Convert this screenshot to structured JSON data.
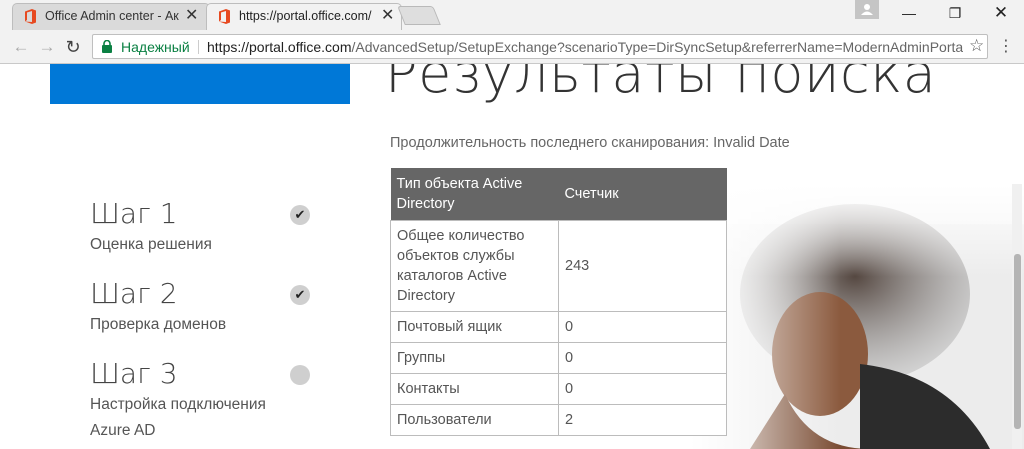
{
  "browser": {
    "tabs": [
      {
        "title": "Office Admin center - Ак",
        "active": false
      },
      {
        "title": "https://portal.office.com/",
        "active": true
      }
    ],
    "address": {
      "secure_label": "Надежный",
      "url_host": "https://portal.office.com",
      "url_rest": "/AdvancedSetup/SetupExchange?scenarioType=DirSyncSetup&referrerName=ModernAdminPortal"
    }
  },
  "page": {
    "heading": "Результаты поиска",
    "duration_text": "Продолжительность последнего сканирования: Invalid Date",
    "steps": [
      {
        "title": "Шаг 1",
        "desc": "Оценка решения",
        "status": "complete"
      },
      {
        "title": "Шаг 2",
        "desc": "Проверка доменов",
        "status": "complete"
      },
      {
        "title": "Шаг 3",
        "desc": "Настройка подключения Azure AD",
        "status": "pending"
      }
    ],
    "table": {
      "headers": [
        "Тип объекта Active Directory",
        "Счетчик"
      ],
      "rows": [
        {
          "type": "Общее количество объектов службы каталогов Active Directory",
          "count": "243"
        },
        {
          "type": "Почтовый ящик",
          "count": "0"
        },
        {
          "type": "Группы",
          "count": "0"
        },
        {
          "type": "Контакты",
          "count": "0"
        },
        {
          "type": "Пользователи",
          "count": "2"
        }
      ]
    }
  },
  "icons": {
    "check": "check-icon",
    "pending": "circle-icon"
  },
  "colors": {
    "accent": "#0078d7",
    "table_header": "#666666",
    "secure": "#0b8043",
    "office_red": "#e74a21"
  }
}
